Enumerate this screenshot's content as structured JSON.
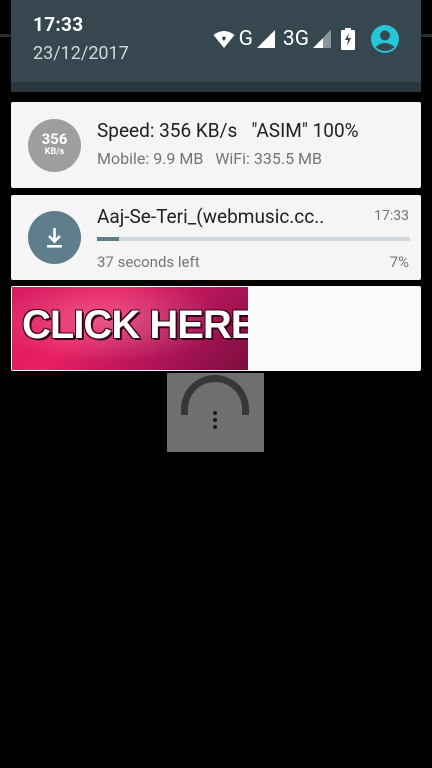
{
  "status_bar": {
    "time": "17:33",
    "date": "23/12/2017",
    "network_1": "G",
    "network_2": "3G",
    "icons": [
      "wifi-icon",
      "signal-icon",
      "signal-icon",
      "battery-charging-icon",
      "account-icon"
    ],
    "accent_color": "#26c6da"
  },
  "notifications": {
    "speed": {
      "badge_value": "356",
      "badge_unit": "KB/s",
      "title": "Speed: 356 KB/s   \"ASIM\" 100%",
      "subtitle": "Mobile: 9.9 MB   WiFi: 335.5 MB"
    },
    "download": {
      "icon": "download-icon",
      "title": "Aaj-Se-Teri_(webmusic.cc..",
      "time": "17:33",
      "progress": 0.07,
      "time_left": "37 seconds left",
      "percent": "7%"
    },
    "ad": {
      "text": "CLICK HERE"
    }
  },
  "overlay": {
    "icon": "overflow-menu-icon"
  }
}
